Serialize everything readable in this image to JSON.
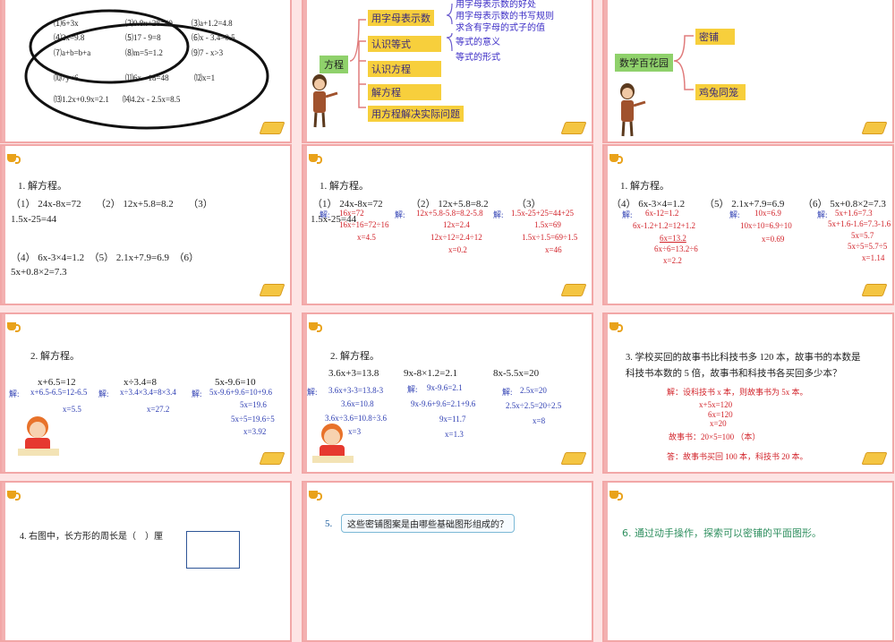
{
  "slide1": {
    "items": [
      "⑴6+3x",
      "⑵0.8x+28=40",
      "⑶a+1.2=4.8",
      "⑷2x=9.8",
      "⑸17 - 9=8",
      "⑹x - 3.4=0.5",
      "⑺a+b=b+a",
      "⑻m=5=1.2",
      "⑼7 - x>3",
      "⑽7y<6",
      "⑾6x - 18=48",
      "⑿x=1",
      "⒀1.2x+0.9x=2.1",
      "⒁4.2x - 2.5x=8.5"
    ]
  },
  "slide2": {
    "root": "方程",
    "nodes": [
      "用字母表示数",
      "认识等式",
      "认识方程",
      "解方程",
      "用方程解决实际问题"
    ],
    "sub": [
      "用字母表示数的好处",
      "用字母表示数的书写规则",
      "求含有字母的式子的值",
      "等式的意义",
      "等式的形式"
    ]
  },
  "slide3": {
    "root": "数学百花园",
    "nodes": [
      "密铺",
      "鸡兔同笼"
    ]
  },
  "slide4": {
    "title": "1. 解方程。",
    "line1": "（1） 24x-8x=72　　（2） 12x+5.8=8.2　　（3）",
    "line2": "1.5x-25=44",
    "line3": "（4） 6x-3×4=1.2　（5） 2.1x+7.9=6.9　（6）",
    "line4": "5x+0.8×2=7.3"
  },
  "slide5": {
    "title": "1. 解方程。",
    "h1": "（1） 24x-8x=72",
    "h2": "（2） 12x+5.8=8.2",
    "h3": "（3）",
    "h4": "1.5x-25=44",
    "jie": "解:",
    "c1": [
      "16x=72",
      "16x÷16=72÷16",
      "x=4.5"
    ],
    "c2": [
      "12x+5.8-5.8=8.2-5.8",
      "12x=2.4",
      "12x÷12=2.4÷12",
      "x=0.2"
    ],
    "c3": [
      "1.5x-25+25=44+25",
      "1.5x=69",
      "1.5x÷1.5=69÷1.5",
      "x=46"
    ]
  },
  "slide6": {
    "title": "1. 解方程。",
    "h1": "（4） 6x-3×4=1.2",
    "h2": "（5） 2.1x+7.9=6.9",
    "h3": "（6） 5x+0.8×2=7.3",
    "jie": "解:",
    "c1": [
      "6x-12=1.2",
      "6x-1.2+1.2=12+1.2",
      "6x=13.2",
      "6x÷6=13.2÷6",
      "x=2.2"
    ],
    "c2": [
      "10x=6.9",
      "10x÷10=6.9÷10",
      "x=0.69"
    ],
    "c3": [
      "5x+1.6=7.3",
      "5x+1.6-1.6=7.3-1.6",
      "5x=5.7",
      "5x÷5=5.7÷5",
      "x=1.14"
    ]
  },
  "slide7": {
    "title": "2. 解方程。",
    "h1": "x+6.5=12",
    "h2": "x÷3.4=8",
    "h3": "5x-9.6=10",
    "jie": "解:",
    "c1": [
      "x+6.5-6.5=12-6.5",
      "x=5.5"
    ],
    "c2": [
      "x÷3.4×3.4=8×3.4",
      "x=27.2"
    ],
    "c3": [
      "5x-9.6+9.6=10+9.6",
      "5x=19.6",
      "5x÷5=19.6÷5",
      "x=3.92"
    ]
  },
  "slide8": {
    "title": "2. 解方程。",
    "h1": "3.6x+3=13.8",
    "h2": "9x-8×1.2=2.1",
    "h3": "8x-5.5x=20",
    "jie": "解:",
    "c1": [
      "3.6x+3-3=13.8-3",
      "3.6x=10.8",
      "3.6x÷3.6=10.8÷3.6",
      "x=3"
    ],
    "c2": [
      "9x-9.6=2.1",
      "9x-9.6+9.6=2.1+9.6",
      "9x=11.7",
      "x=1.3"
    ],
    "c3": [
      "2.5x=20",
      "2.5x÷2.5=20÷2.5",
      "x=8"
    ]
  },
  "slide9": {
    "q1": "3. 学校买回的故事书比科技书多 120 本，故事书的本数是",
    "q2": "科技书本数的 5 倍，故事书和科技书各买回多少本？",
    "a1": "解：设科技书 x 本，则故事书为 5x 本。",
    "a2": "x+5x=120",
    "a3": "6x=120",
    "a4": "x=20",
    "a5": "故事书：20×5=100 （本）",
    "a6": "答：故事书买回 100 本，科技书 20 本。"
  },
  "slide10": {
    "text": "4. 右图中，长方形的周长是（　）厘"
  },
  "slide11": {
    "num": "5.",
    "text": "这些密铺图案是由哪些基础图形组成的？"
  },
  "slide12": {
    "text": "6. 通过动手操作，探索可以密铺的平面图形。"
  },
  "colors": {
    "background": "#fde4e4",
    "border": "#f2a7a7",
    "accent": "#f7cf3c",
    "answer": "#d2232a",
    "mindmap_text": "#3b2cc6"
  }
}
